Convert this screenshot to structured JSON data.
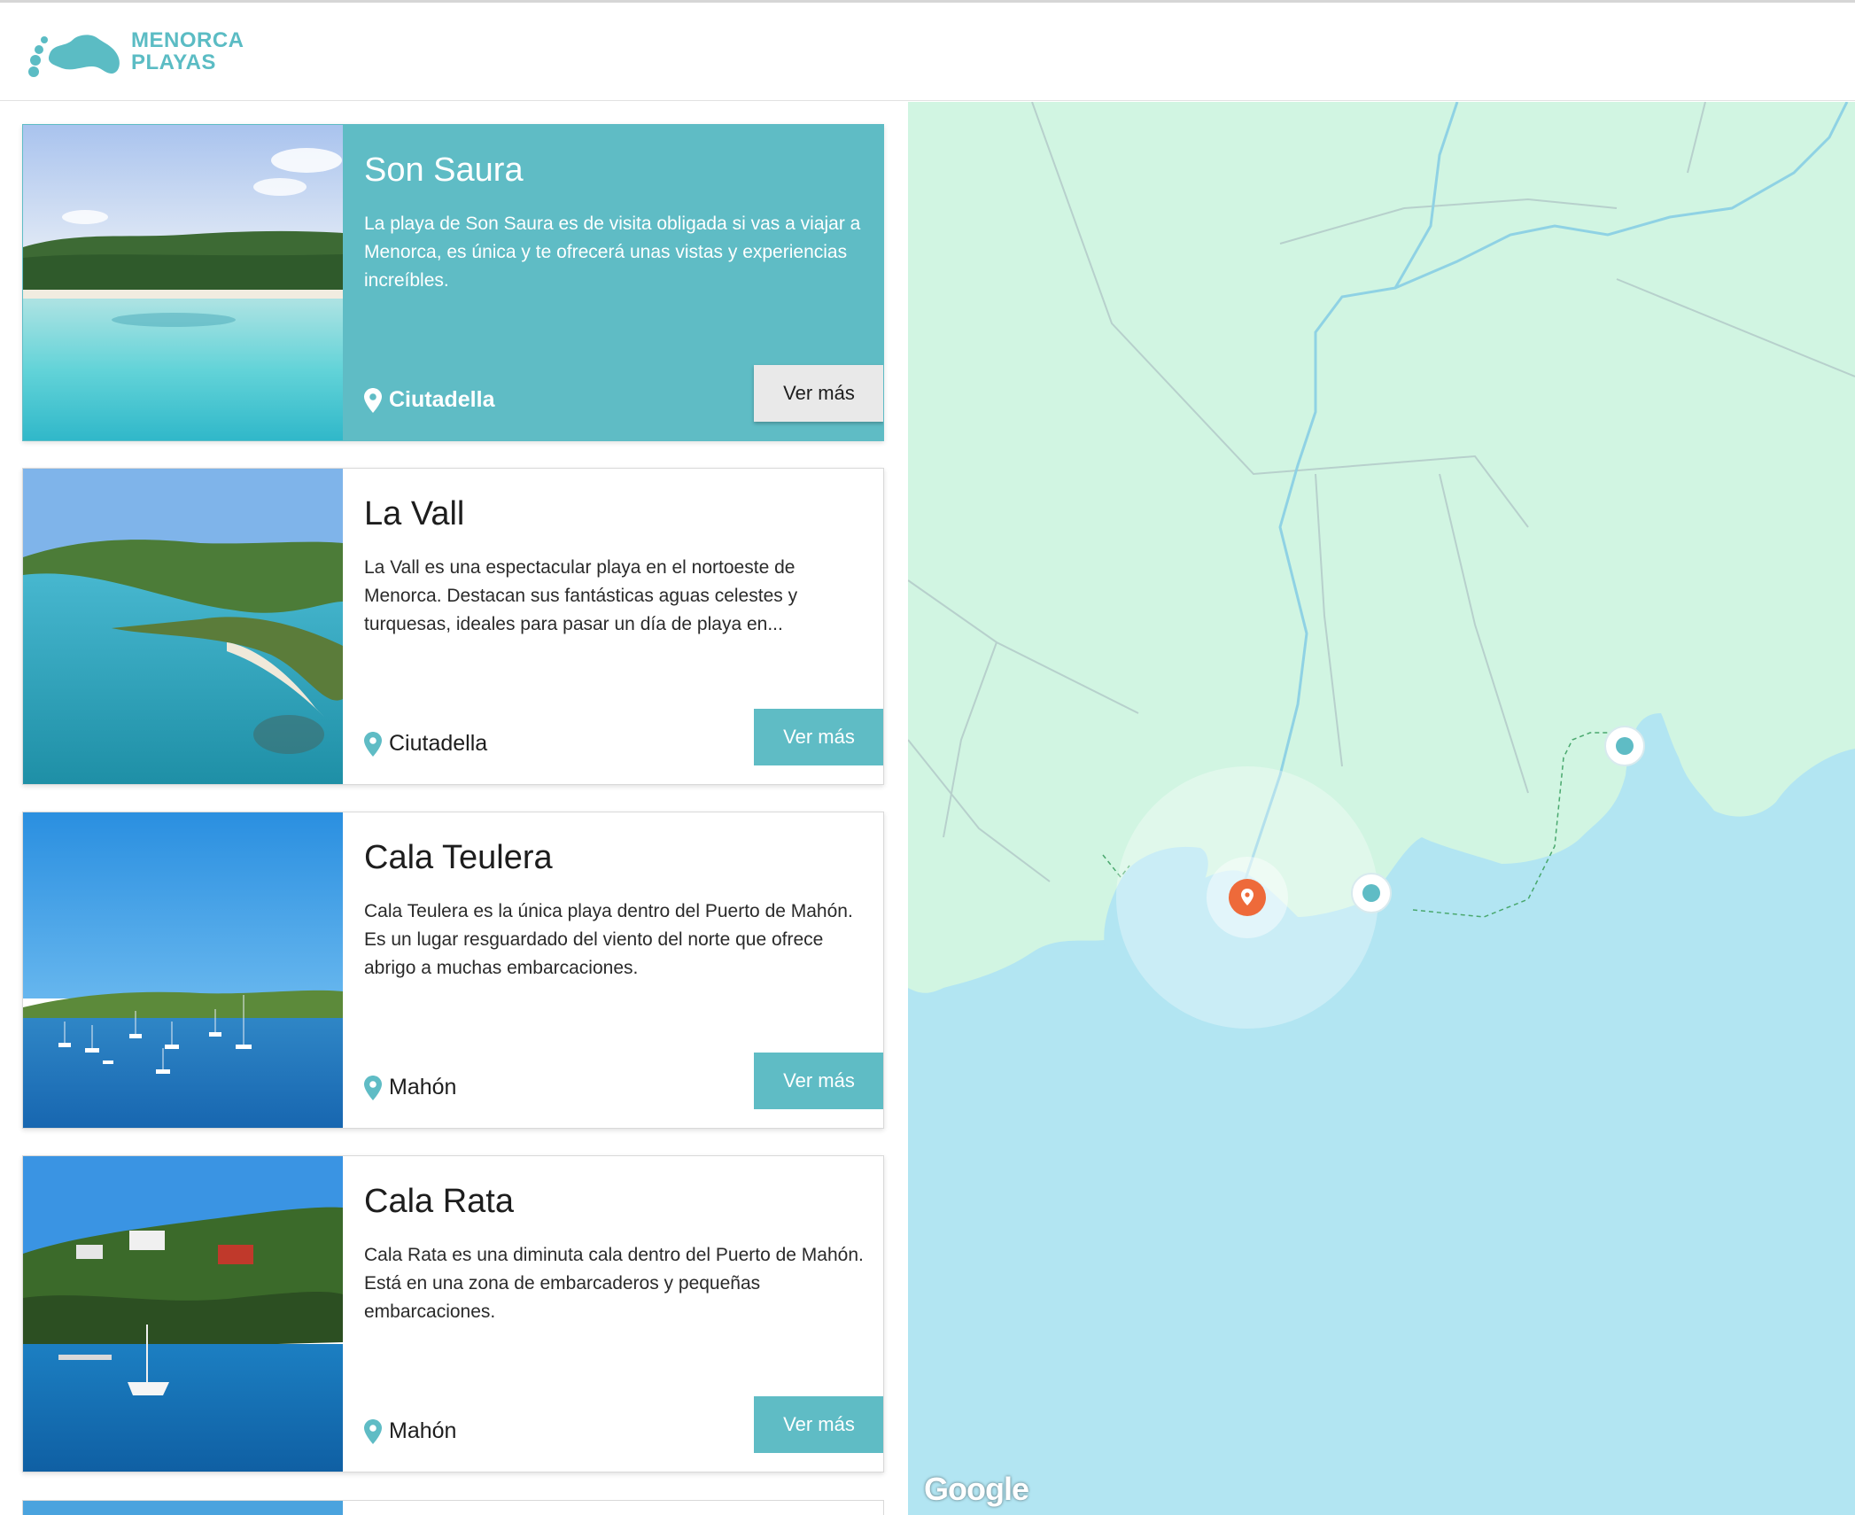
{
  "brand": {
    "line1": "MENORCA",
    "line2": "PLAYAS",
    "color": "#5bbcc4"
  },
  "colors": {
    "accent": "#5fbcc5",
    "land": "#d1f5e2",
    "sea": "#b2e5f2",
    "active_marker": "#ee6a3a"
  },
  "beaches": [
    {
      "title": "Son Saura",
      "description": "La playa de Son Saura es de visita obligada si vas a viajar a Menorca, es única y te ofrecerá unas vistas y experiencias increíbles.",
      "location": "Ciutadella",
      "button": "Ver más",
      "active": true
    },
    {
      "title": "La Vall",
      "description": "La Vall es una espectacular playa en el nortoeste de Menorca. Destacan sus fantásticas aguas celestes y turquesas, ideales para pasar un día de playa en...",
      "location": "Ciutadella",
      "button": "Ver más",
      "active": false
    },
    {
      "title": "Cala Teulera",
      "description": "Cala Teulera es la única playa dentro del Puerto de Mahón. Es un lugar resguardado del viento del norte que ofrece abrigo a muchas embarcaciones.",
      "location": "Mahón",
      "button": "Ver más",
      "active": false
    },
    {
      "title": "Cala Rata",
      "description": "Cala Rata es una diminuta cala dentro del Puerto de Mahón. Está en una zona de embarcaderos y pequeñas embarcaciones.",
      "location": "Mahón",
      "button": "Ver más",
      "active": false
    }
  ],
  "map": {
    "attribution": "Google"
  }
}
